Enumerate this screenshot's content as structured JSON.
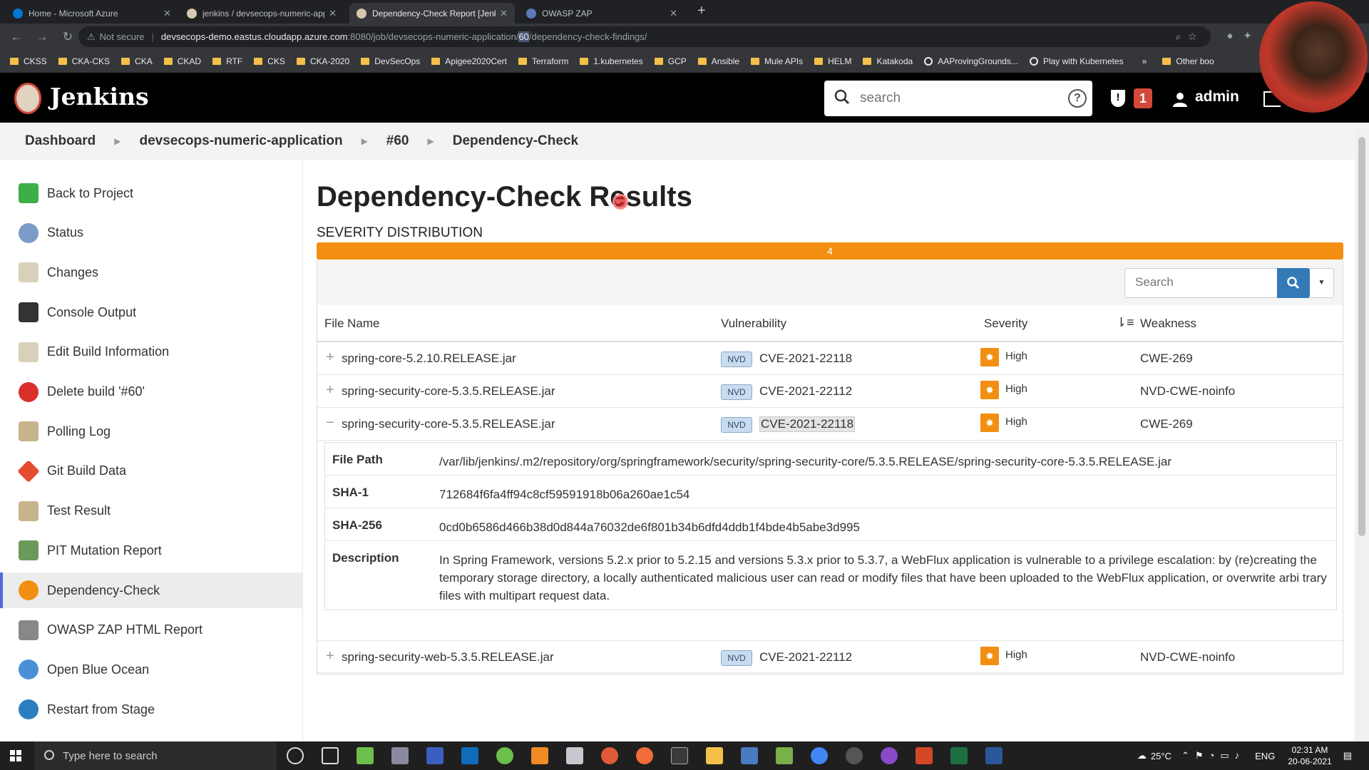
{
  "browser": {
    "tabs": [
      {
        "title": "Home - Microsoft Azure",
        "active": false
      },
      {
        "title": "jenkins / devsecops-numeric-app",
        "active": false
      },
      {
        "title": "Dependency-Check Report [Jenki",
        "active": true
      },
      {
        "title": "OWASP ZAP",
        "active": false
      }
    ],
    "security_label": "Not secure",
    "url_host": "devsecops-demo.eastus.cloudapp.azure.com",
    "url_path_1": ":8080/job/devsecops-numeric-application/",
    "url_path_hl": "60",
    "url_path_2": "/dependency-check-findings/",
    "bookmarks": [
      "CKSS",
      "CKA-CKS",
      "CKA",
      "CKAD",
      "RTF",
      "CKS",
      "CKA-2020",
      "DevSecOps",
      "Apigee2020Cert",
      "Terraform",
      "1.kubernetes",
      "GCP",
      "Ansible",
      "Mule APIs",
      "HELM",
      "Katakoda",
      "AAProvingGrounds...",
      "Play with Kubernetes"
    ],
    "bookmarks_more": "»",
    "other_bookmarks": "Other boo"
  },
  "jenkins": {
    "title": "Jenkins",
    "search_placeholder": "search",
    "alert_count": "1",
    "username": "admin"
  },
  "breadcrumb": [
    "Dashboard",
    "devsecops-numeric-application",
    "#60",
    "Dependency-Check"
  ],
  "sidebar": [
    {
      "label": "Back to Project",
      "icon": "arrow-up-icon",
      "color": "#3fae49"
    },
    {
      "label": "Status",
      "icon": "magnifier-icon",
      "color": "#7a9cc6"
    },
    {
      "label": "Changes",
      "icon": "notepad-icon",
      "color": "#d8d0b8"
    },
    {
      "label": "Console Output",
      "icon": "terminal-icon",
      "color": "#333333"
    },
    {
      "label": "Edit Build Information",
      "icon": "notepad-edit-icon",
      "color": "#d8d0b8"
    },
    {
      "label": "Delete build '#60'",
      "icon": "no-entry-icon",
      "color": "#d9302c"
    },
    {
      "label": "Polling Log",
      "icon": "clipboard-icon",
      "color": "#c8b48a"
    },
    {
      "label": "Git Build Data",
      "icon": "git-icon",
      "color": "#e44c30"
    },
    {
      "label": "Test Result",
      "icon": "clipboard-icon",
      "color": "#c8b48a"
    },
    {
      "label": "PIT Mutation Report",
      "icon": "pit-icon",
      "color": "#6a9a5a"
    },
    {
      "label": "Dependency-Check",
      "icon": "dependency-check-icon",
      "color": "#f28f13",
      "active": true
    },
    {
      "label": "OWASP ZAP HTML Report",
      "icon": "report-icon",
      "color": "#888888"
    },
    {
      "label": "Open Blue Ocean",
      "icon": "blue-ocean-icon",
      "color": "#4a90d9"
    },
    {
      "label": "Restart from Stage",
      "icon": "restart-icon",
      "color": "#2a7fc0"
    }
  ],
  "main": {
    "title": "Dependency-Check Results",
    "severity_label": "SEVERITY DISTRIBUTION",
    "severity_count": "4",
    "table_search_placeholder": "Search",
    "columns": [
      "File Name",
      "Vulnerability",
      "Severity",
      "Weakness"
    ],
    "rows": [
      {
        "file": "spring-core-5.2.10.RELEASE.jar",
        "source": "NVD",
        "cve": "CVE-2021-22118",
        "severity": "High",
        "weakness": "CWE-269",
        "expanded": false
      },
      {
        "file": "spring-security-core-5.3.5.RELEASE.jar",
        "source": "NVD",
        "cve": "CVE-2021-22112",
        "severity": "High",
        "weakness": "NVD-CWE-noinfo",
        "expanded": false
      },
      {
        "file": "spring-security-core-5.3.5.RELEASE.jar",
        "source": "NVD",
        "cve": "CVE-2021-22118",
        "severity": "High",
        "weakness": "CWE-269",
        "expanded": true
      },
      {
        "file": "spring-security-web-5.3.5.RELEASE.jar",
        "source": "NVD",
        "cve": "CVE-2021-22112",
        "severity": "High",
        "weakness": "NVD-CWE-noinfo",
        "expanded": false
      }
    ],
    "detail": {
      "file_path_label": "File Path",
      "file_path": "/var/lib/jenkins/.m2/repository/org/springframework/security/spring-security-core/5.3.5.RELEASE/spring-security-core-5.3.5.RELEASE.jar",
      "sha1_label": "SHA-1",
      "sha1": "712684f6fa4ff94c8cf59591918b06a260ae1c54",
      "sha256_label": "SHA-256",
      "sha256": "0cd0b6586d466b38d0d844a76032de6f801b34b6dfd4ddb1f4bde4b5abe3d995",
      "description_label": "Description",
      "description": "In Spring Framework, versions 5.2.x prior to 5.2.15 and versions 5.3.x prior to 5.3.7, a WebFlux application is vulnerable to a privilege escalation: by (re)creating the temporary storage directory, a locally authenticated malicious user can read or modify files that have been uploaded to the WebFlux application, or overwrite arbi trary files with multipart request data."
    }
  },
  "taskbar": {
    "search_placeholder": "Type here to search",
    "temperature": "25°C",
    "language": "ENG",
    "time": "02:31 AM",
    "date": "20-06-2021"
  }
}
